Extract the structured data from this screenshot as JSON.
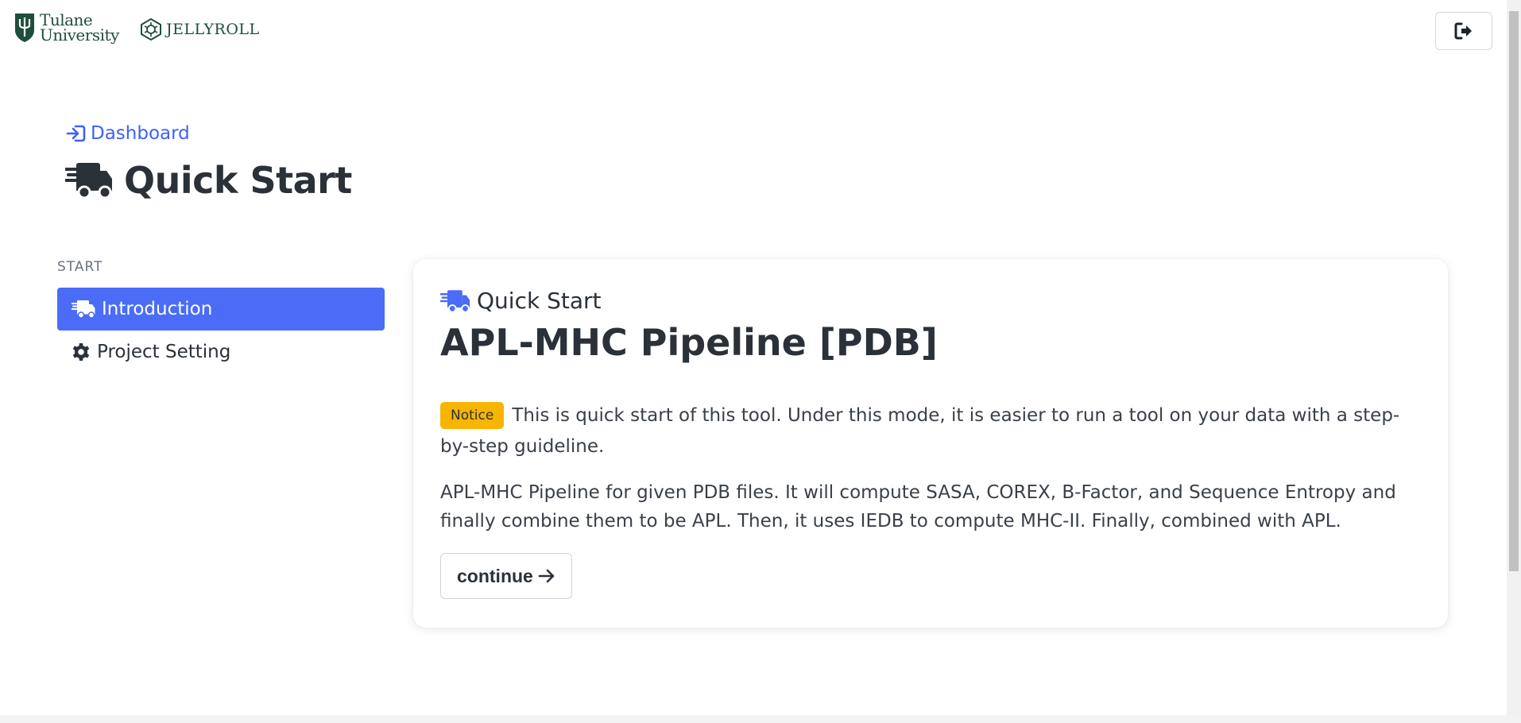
{
  "header": {
    "tulane_logo_line1": "Tulane",
    "tulane_logo_line2": "University",
    "jellyroll_logo": "JELLYROLL",
    "logout_icon": "sign-out-icon"
  },
  "breadcrumb": {
    "label": "Dashboard",
    "icon": "sign-in-icon"
  },
  "page": {
    "title": "Quick Start",
    "icon": "truck-fast-icon"
  },
  "sidebar": {
    "section": "START",
    "items": [
      {
        "label": "Introduction",
        "icon": "truck-fast-icon",
        "active": true
      },
      {
        "label": "Project Setting",
        "icon": "gear-icon",
        "active": false
      }
    ]
  },
  "card": {
    "kicker": "Quick Start",
    "title": "APL-MHC Pipeline [PDB]",
    "notice_badge": "Notice",
    "notice_text": "This is quick start of this tool. Under this mode, it is easier to run a tool on your data with a step-by-step guideline.",
    "description": "APL-MHC Pipeline for given PDB files. It will compute SASA, COREX, B-Factor, and Sequence Entropy and finally combine them to be APL. Then, it uses IEDB to compute MHC-II. Finally, combined with APL.",
    "continue_label": "continue"
  },
  "colors": {
    "accent": "#4a6cf7",
    "link": "#3b63f5",
    "notice": "#f7b500",
    "brand_green": "#1f4e3d"
  }
}
